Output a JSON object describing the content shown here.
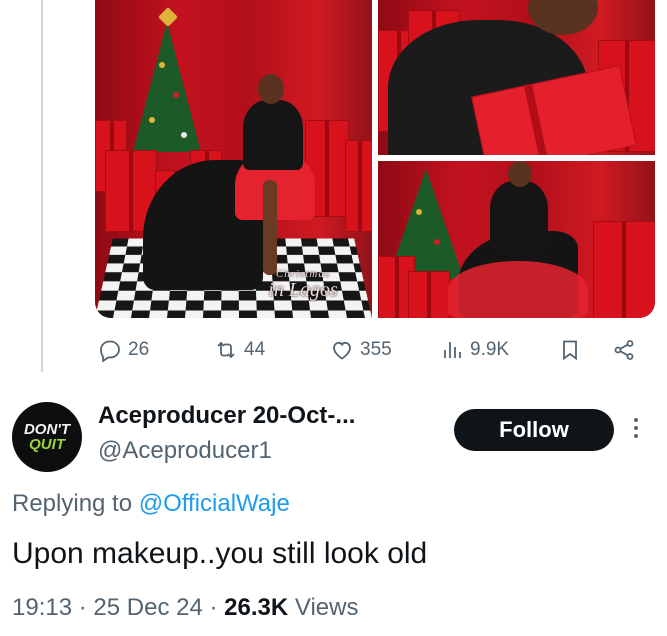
{
  "media": {
    "watermark_line1": "Christmas",
    "watermark_line2": "in Lagos"
  },
  "actions": {
    "replies": "26",
    "reposts": "44",
    "likes": "355",
    "views": "9.9K"
  },
  "icons": {
    "reply": "reply-icon",
    "repost": "repost-icon",
    "like": "heart-icon",
    "views": "views-bar-chart-icon",
    "bookmark": "bookmark-icon",
    "share": "share-icon",
    "more": "more-vertical-icon"
  },
  "reply_tweet": {
    "avatar_line1": "DON'T",
    "avatar_line2": "QUIT",
    "display_name": "Aceproducer 20-Oct-...",
    "handle": "@Aceproducer1",
    "follow_label": "Follow",
    "replying_prefix": "Replying to",
    "replying_mention": "@OfficialWaje",
    "text": "Upon makeup..you still look old",
    "time": "19:13",
    "date": "25 Dec 24",
    "views_count": "26.3K",
    "views_label": "Views"
  },
  "colors": {
    "accent_blue": "#1d9bf0",
    "text_primary": "#0f1419",
    "text_secondary": "#536471",
    "follow_button": "#0f1419"
  }
}
